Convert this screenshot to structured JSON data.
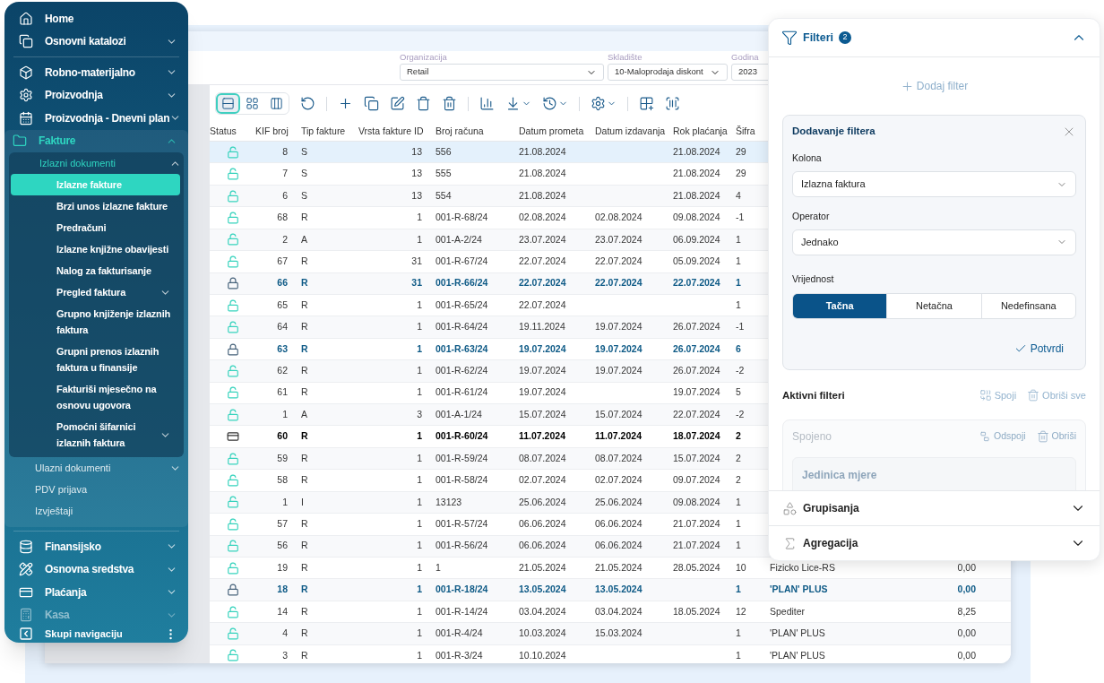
{
  "sidebar": {
    "sections": [
      {
        "items": [
          {
            "label": "Home",
            "active": false,
            "faded": false
          },
          {
            "label": "Osnovni katalozi",
            "active": false,
            "faded": false,
            "expanded": false
          }
        ]
      },
      {
        "items": [
          {
            "label": "Robno-materijalno",
            "active": false,
            "faded": false,
            "expanded": false
          },
          {
            "label": "Proizvodnja",
            "active": false,
            "faded": false,
            "expanded": false
          },
          {
            "label": "Proizvodnja - Dnevni plan",
            "active": false,
            "faded": false,
            "expanded": false
          },
          {
            "label": "Fakture",
            "active": true,
            "faded": false,
            "expanded": true,
            "children": [
              {
                "label": "Izlazni dokumenti",
                "active": true,
                "expanded": true,
                "children": [
                  {
                    "label": "Izlazne fakture",
                    "selected": true
                  },
                  {
                    "label": "Brzi unos izlazne fakture",
                    "selected": false
                  },
                  {
                    "label": "Predračuni",
                    "selected": false
                  },
                  {
                    "label": "Izlazne knjižne obavijesti",
                    "selected": false
                  },
                  {
                    "label": "Nalog za fakturisanje",
                    "selected": false
                  },
                  {
                    "label": "Pregled faktura",
                    "selected": false,
                    "expanded": false
                  },
                  {
                    "label": "Grupno knjiženje izlaznih faktura",
                    "selected": false
                  },
                  {
                    "label": "Grupni prenos izlaznih faktura u finansije",
                    "selected": false
                  },
                  {
                    "label": "Fakturiši mjesečno na osnovu ugovora",
                    "selected": false
                  },
                  {
                    "label": "Pomoćni šifarnici izlaznih faktura",
                    "selected": false,
                    "expanded": false
                  }
                ]
              },
              {
                "label": "Ulazni dokumenti",
                "active": false,
                "expanded": false
              },
              {
                "label": "PDV prijava",
                "active": false
              },
              {
                "label": "Izvještaji",
                "active": false
              }
            ]
          }
        ]
      },
      {
        "items": [
          {
            "label": "Finansijsko",
            "active": false,
            "faded": false,
            "expanded": false
          },
          {
            "label": "Osnovna sredstva",
            "active": false,
            "faded": false,
            "expanded": false
          },
          {
            "label": "Plaćanja",
            "active": false,
            "faded": false,
            "expanded": false
          },
          {
            "label": "Kasa",
            "active": false,
            "faded": true,
            "expanded": false
          }
        ]
      }
    ],
    "collapse_label": "Skupi navigaciju"
  },
  "header_fields": [
    {
      "label": "Organizacija",
      "value": "Retail"
    },
    {
      "label": "Skladište",
      "value": "10-Maloprodaja diskont"
    },
    {
      "label": "Godina",
      "value": "2023"
    }
  ],
  "toolbar": {
    "view_modes": [
      {
        "selected": true
      },
      {
        "selected": false
      },
      {
        "selected": false
      }
    ]
  },
  "table": {
    "columns": [
      "Status",
      "KIF broj",
      "Tip fakture",
      "Vrsta fakture ID",
      "Broj računa",
      "Datum prometa",
      "Datum izdavanja",
      "Rok plaćanja",
      "Šifra"
    ],
    "rows": [
      {
        "kind": "open",
        "selected": true,
        "kif_broj": "8",
        "tip_fakture": "S",
        "vrsta_fakture_id": "13",
        "broj_racuna": "556",
        "datum_prometa": "21.08.2024",
        "rok_placanja": "21.08.2024",
        "sifra": "29"
      },
      {
        "kind": "open",
        "selected": false,
        "kif_broj": "7",
        "tip_fakture": "S",
        "vrsta_fakture_id": "13",
        "broj_racuna": "555",
        "datum_prometa": "21.08.2024",
        "rok_placanja": "21.08.2024",
        "sifra": "29"
      },
      {
        "kind": "open",
        "selected": false,
        "kif_broj": "6",
        "tip_fakture": "S",
        "vrsta_fakture_id": "13",
        "broj_racuna": "554",
        "datum_prometa": "21.08.2024",
        "rok_placanja": "21.08.2024",
        "sifra": "4"
      },
      {
        "kind": "open",
        "selected": false,
        "kif_broj": "68",
        "tip_fakture": "R",
        "vrsta_fakture_id": "1",
        "broj_racuna": "001-R-68/24",
        "datum_prometa": "02.08.2024",
        "datum_izdavanja": "02.08.2024",
        "rok_placanja": "09.08.2024",
        "sifra": "-1"
      },
      {
        "kind": "open",
        "selected": false,
        "kif_broj": "2",
        "tip_fakture": "A",
        "vrsta_fakture_id": "1",
        "broj_racuna": "001-A-2/24",
        "datum_prometa": "23.07.2024",
        "datum_izdavanja": "23.07.2024",
        "rok_placanja": "06.09.2024",
        "sifra": "1"
      },
      {
        "kind": "open",
        "selected": false,
        "kif_broj": "67",
        "tip_fakture": "R",
        "vrsta_fakture_id": "31",
        "broj_racuna": "001-R-67/24",
        "datum_prometa": "22.07.2024",
        "datum_izdavanja": "22.07.2024",
        "rok_placanja": "05.09.2024",
        "sifra": "1"
      },
      {
        "kind": "locked",
        "selected": false,
        "kif_broj": "66",
        "tip_fakture": "R",
        "vrsta_fakture_id": "31",
        "broj_racuna": "001-R-66/24",
        "datum_prometa": "22.07.2024",
        "datum_izdavanja": "22.07.2024",
        "rok_placanja": "22.07.2024",
        "sifra": "1"
      },
      {
        "kind": "open",
        "selected": false,
        "kif_broj": "65",
        "tip_fakture": "R",
        "vrsta_fakture_id": "1",
        "broj_racuna": "001-R-65/24",
        "datum_prometa": "22.07.2024",
        "sifra": "1"
      },
      {
        "kind": "open",
        "selected": false,
        "kif_broj": "64",
        "tip_fakture": "R",
        "vrsta_fakture_id": "1",
        "broj_racuna": "001-R-64/24",
        "datum_prometa": "19.11.2024",
        "datum_izdavanja": "19.07.2024",
        "rok_placanja": "26.07.2024",
        "sifra": "-1"
      },
      {
        "kind": "locked",
        "selected": false,
        "kif_broj": "63",
        "tip_fakture": "R",
        "vrsta_fakture_id": "1",
        "broj_racuna": "001-R-63/24",
        "datum_prometa": "19.07.2024",
        "datum_izdavanja": "19.07.2024",
        "rok_placanja": "26.07.2024",
        "sifra": "6"
      },
      {
        "kind": "open",
        "selected": false,
        "kif_broj": "62",
        "tip_fakture": "R",
        "vrsta_fakture_id": "1",
        "broj_racuna": "001-R-62/24",
        "datum_prometa": "19.07.2024",
        "datum_izdavanja": "19.07.2024",
        "rok_placanja": "26.07.2024",
        "sifra": "-2"
      },
      {
        "kind": "open",
        "selected": false,
        "kif_broj": "61",
        "tip_fakture": "R",
        "vrsta_fakture_id": "1",
        "broj_racuna": "001-R-61/24",
        "datum_prometa": "19.07.2024",
        "rok_placanja": "19.07.2024",
        "sifra": "5"
      },
      {
        "kind": "open",
        "selected": false,
        "kif_broj": "1",
        "tip_fakture": "A",
        "vrsta_fakture_id": "3",
        "broj_racuna": "001-A-1/24",
        "datum_prometa": "15.07.2024",
        "datum_izdavanja": "15.07.2024",
        "rok_placanja": "22.07.2024",
        "sifra": "-2"
      },
      {
        "kind": "card",
        "selected": false,
        "kif_broj": "60",
        "tip_fakture": "R",
        "vrsta_fakture_id": "1",
        "broj_racuna": "001-R-60/24",
        "datum_prometa": "11.07.2024",
        "datum_izdavanja": "11.07.2024",
        "rok_placanja": "18.07.2024",
        "sifra": "2"
      },
      {
        "kind": "open",
        "selected": false,
        "kif_broj": "59",
        "tip_fakture": "R",
        "vrsta_fakture_id": "1",
        "broj_racuna": "001-R-59/24",
        "datum_prometa": "08.07.2024",
        "datum_izdavanja": "08.07.2024",
        "rok_placanja": "15.07.2024",
        "sifra": "2"
      },
      {
        "kind": "open",
        "selected": false,
        "kif_broj": "58",
        "tip_fakture": "R",
        "vrsta_fakture_id": "1",
        "broj_racuna": "001-R-58/24",
        "datum_prometa": "02.07.2024",
        "datum_izdavanja": "02.07.2024",
        "rok_placanja": "09.07.2024",
        "sifra": "2"
      },
      {
        "kind": "open",
        "selected": false,
        "kif_broj": "1",
        "tip_fakture": "I",
        "vrsta_fakture_id": "1",
        "broj_racuna": "13123",
        "datum_prometa": "25.06.2024",
        "datum_izdavanja": "25.06.2024",
        "rok_placanja": "09.08.2024",
        "sifra": "1"
      },
      {
        "kind": "open",
        "selected": false,
        "kif_broj": "57",
        "tip_fakture": "R",
        "vrsta_fakture_id": "1",
        "broj_racuna": "001-R-57/24",
        "datum_prometa": "06.06.2024",
        "datum_izdavanja": "06.06.2024",
        "rok_placanja": "21.07.2024",
        "sifra": "1"
      },
      {
        "kind": "open",
        "selected": false,
        "kif_broj": "56",
        "tip_fakture": "R",
        "vrsta_fakture_id": "1",
        "broj_racuna": "001-R-56/24",
        "datum_prometa": "06.06.2024",
        "datum_izdavanja": "06.06.2024",
        "rok_placanja": "21.07.2024",
        "sifra": "1"
      },
      {
        "kind": "open",
        "selected": false,
        "kif_broj": "19",
        "tip_fakture": "R",
        "vrsta_fakture_id": "1",
        "broj_racuna": "1",
        "datum_prometa": "21.05.2024",
        "datum_izdavanja": "21.05.2024",
        "rok_placanja": "28.05.2024",
        "sifra": "10",
        "column_10": "Fizicko Lice-RS",
        "column_11": "0,00"
      },
      {
        "kind": "locked",
        "selected": false,
        "kif_broj": "18",
        "tip_fakture": "R",
        "vrsta_fakture_id": "1",
        "broj_racuna": "001-R-18/24",
        "datum_prometa": "13.05.2024",
        "datum_izdavanja": "13.05.2024",
        "sifra": "1",
        "column_10": "'PLAN' PLUS",
        "column_11": "0,00"
      },
      {
        "kind": "open",
        "selected": false,
        "kif_broj": "14",
        "tip_fakture": "R",
        "vrsta_fakture_id": "1",
        "broj_racuna": "001-R-14/24",
        "datum_prometa": "03.04.2024",
        "datum_izdavanja": "03.04.2024",
        "rok_placanja": "18.05.2024",
        "sifra": "12",
        "column_10": "Spediter",
        "column_11": "8,25"
      },
      {
        "kind": "open",
        "selected": false,
        "kif_broj": "4",
        "tip_fakture": "R",
        "vrsta_fakture_id": "1",
        "broj_racuna": "001-R-4/24",
        "datum_prometa": "10.03.2024",
        "datum_izdavanja": "15.03.2024",
        "sifra": "1",
        "column_10": "'PLAN' PLUS",
        "column_11": "0,00"
      },
      {
        "kind": "open",
        "selected": false,
        "kif_broj": "3",
        "tip_fakture": "R",
        "vrsta_fakture_id": "1",
        "broj_racuna": "001-R-3/24",
        "datum_prometa": "10.10.2024",
        "sifra": "1",
        "column_10": "'PLAN' PLUS",
        "column_11": "0,00"
      }
    ]
  },
  "filter_panel": {
    "title": "Filteri",
    "count": "2",
    "expanded": true,
    "add_label": "Dodaj filter",
    "editor": {
      "title": "Dodavanje filtera",
      "fields": [
        {
          "label": "Kolona",
          "value": "Izlazna faktura"
        },
        {
          "label": "Operator",
          "value": "Jednako"
        }
      ],
      "value_label": "Vrijednost",
      "options": [
        {
          "label": "Tačna",
          "selected": true
        },
        {
          "label": "Netačna",
          "selected": false
        },
        {
          "label": "Nedefinsana",
          "selected": false
        }
      ],
      "confirm_label": "Potvrdi"
    },
    "active": {
      "title": "Aktivni filteri",
      "merge_label": "Spoji",
      "clear_label": "Obriši sve",
      "group": {
        "title": "Spojeno",
        "unmerge_label": "Odspoji",
        "delete_label": "Obriši",
        "filter_title": "Jedinica mjere"
      }
    },
    "sections": [
      {
        "title": "Grupisanja",
        "expanded": false
      },
      {
        "title": "Agregacija",
        "expanded": false
      }
    ]
  }
}
